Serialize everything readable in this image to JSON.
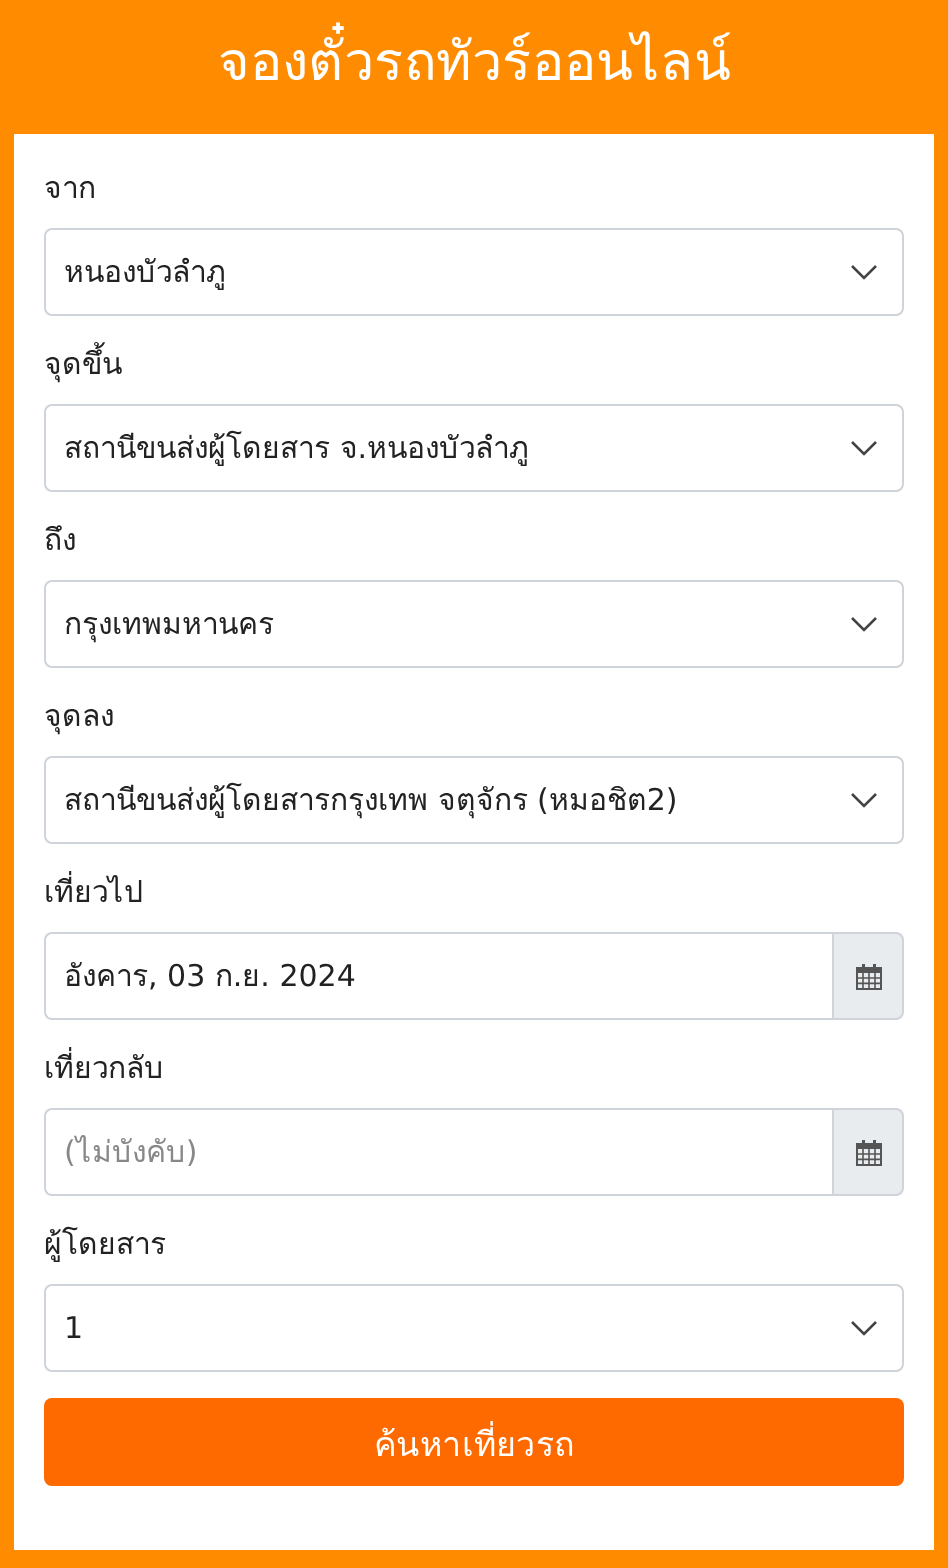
{
  "header": {
    "title": "จองตั๋วรถทัวร์ออนไลน์"
  },
  "fields": [
    {
      "kind": "select",
      "label": "จาก",
      "value": "หนองบัวลำภู"
    },
    {
      "kind": "select",
      "label": "จุดขึ้น",
      "value": "สถานีขนส่งผู้โดยสาร จ.หนองบัวลำภู"
    },
    {
      "kind": "select",
      "label": "ถึง",
      "value": "กรุงเทพมหานคร"
    },
    {
      "kind": "select",
      "label": "จุดลง",
      "value": "สถานีขนส่งผู้โดยสารกรุงเทพ จตุจักร (หมอชิต2)"
    },
    {
      "kind": "date",
      "label": "เที่ยวไป",
      "value": "อังคาร, 03 ก.ย. 2024"
    },
    {
      "kind": "date",
      "label": "เที่ยวกลับ",
      "placeholder": "(ไม่บังคับ)"
    },
    {
      "kind": "select",
      "label": "ผู้โดยสาร",
      "value": "1"
    }
  ],
  "button": {
    "label": "ค้นหาเที่ยวรถ"
  }
}
